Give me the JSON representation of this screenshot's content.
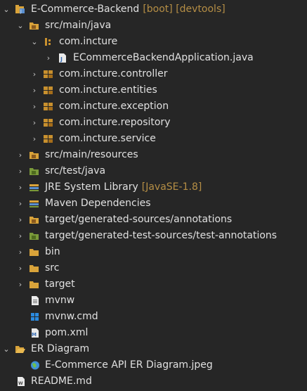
{
  "tree": {
    "project": {
      "label": "E-Commerce-Backend",
      "decoration": "[boot] [devtools]",
      "expanded": true,
      "icon": "java-project-icon"
    },
    "src_main_java": {
      "label": "src/main/java",
      "expanded": true,
      "icon": "source-folder-icon"
    },
    "pkg_root": {
      "label": "com.incture",
      "expanded": true,
      "icon": "package-icon"
    },
    "main_class": {
      "label": "ECommerceBackendApplication.java",
      "expanded": false,
      "icon": "java-file-icon"
    },
    "packages": [
      {
        "label": "com.incture.controller",
        "icon": "package-icon"
      },
      {
        "label": "com.incture.entities",
        "icon": "package-icon"
      },
      {
        "label": "com.incture.exception",
        "icon": "package-icon"
      },
      {
        "label": "com.incture.repository",
        "icon": "package-icon"
      },
      {
        "label": "com.incture.service",
        "icon": "package-icon"
      }
    ],
    "src_main_resources": {
      "label": "src/main/resources",
      "icon": "source-folder-icon"
    },
    "src_test_java": {
      "label": "src/test/java",
      "icon": "test-source-folder-icon"
    },
    "jre": {
      "label": "JRE System Library",
      "decoration": "[JavaSE-1.8]",
      "icon": "library-icon"
    },
    "maven": {
      "label": "Maven Dependencies",
      "icon": "library-icon"
    },
    "gen_annotations": {
      "label": "target/generated-sources/annotations",
      "icon": "source-folder-icon"
    },
    "gen_test_annotations": {
      "label": "target/generated-test-sources/test-annotations",
      "icon": "test-source-folder-icon"
    },
    "bin": {
      "label": "bin",
      "icon": "folder-icon"
    },
    "src": {
      "label": "src",
      "icon": "folder-icon"
    },
    "target": {
      "label": "target",
      "icon": "folder-icon"
    },
    "mvnw": {
      "label": "mvnw",
      "icon": "text-file-icon"
    },
    "mvnw_cmd": {
      "label": "mvnw.cmd",
      "icon": "windows-file-icon"
    },
    "pom": {
      "label": "pom.xml",
      "icon": "maven-pom-icon"
    },
    "er_folder": {
      "label": "ER Diagram",
      "expanded": true,
      "icon": "open-folder-icon"
    },
    "er_image": {
      "label": "E-Commerce API ER Diagram.jpeg",
      "icon": "globe-image-icon"
    },
    "readme": {
      "label": "README.md",
      "icon": "markdown-file-icon"
    }
  },
  "colors": {
    "background": "#262626",
    "text": "#e0e0e0",
    "decoration": "#b58e45",
    "folder": "#d9a33a",
    "package": "#c8902e",
    "test_folder": "#7a9a3a",
    "library": "#5a8fcf"
  }
}
